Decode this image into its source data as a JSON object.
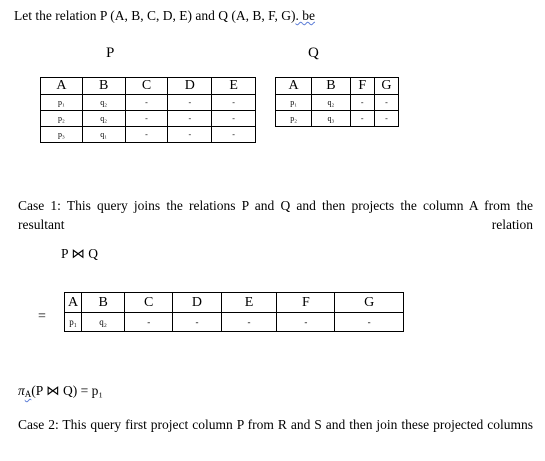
{
  "intro": {
    "pre": "Let the relation P (A, B, C, D, E) and Q (A, B, F, G)",
    "mid": ". ",
    "post": "be"
  },
  "p_label": "P",
  "q_label": "Q",
  "p_table": {
    "headers": [
      "A",
      "B",
      "C",
      "D",
      "E"
    ],
    "rows": [
      [
        "p₁",
        "q₂",
        "-",
        "-",
        "-"
      ],
      [
        "p₂",
        "q₂",
        "-",
        "-",
        "-"
      ],
      [
        "p₃",
        "q₁",
        "-",
        "-",
        "-"
      ]
    ]
  },
  "q_table": {
    "headers": [
      "A",
      "B",
      "F",
      "G"
    ],
    "rows": [
      [
        "p₁",
        "q₂",
        "-",
        "-"
      ],
      [
        "p₂",
        "q₃",
        "-",
        "-"
      ]
    ]
  },
  "case1": "Case 1: This query joins the relations P and Q and then projects the column A from the resultant relation",
  "join_expr": "P ⋈ Q",
  "equals": "=",
  "result_table": {
    "headers": [
      "A",
      "B",
      "C",
      "D",
      "E",
      "F",
      "G"
    ],
    "rows": [
      [
        "p₁",
        "q₂",
        "-",
        "-",
        "-",
        "-",
        "-"
      ]
    ]
  },
  "projection": {
    "pi": "π",
    "sub": "A",
    "body": "(P ⋈ Q) = p₁"
  },
  "case2": "Case 2: This query first project column P from R and S and then join these projected columns"
}
